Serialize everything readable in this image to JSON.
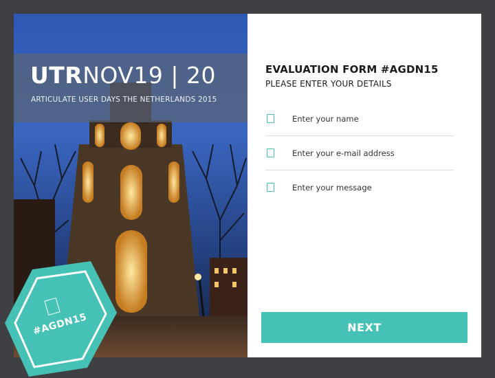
{
  "header": {
    "title_bold": "UTR",
    "title_rest": "NOV19 | 20",
    "subtitle": "ARTICULATE USER DAYS THE NETHERLANDS 2015"
  },
  "badge": {
    "label": "#AGDN15",
    "icon": "document-icon",
    "color": "#45c2b5"
  },
  "form": {
    "title": "EVALUATION FORM #AGDN15",
    "subtitle": "PLEASE ENTER YOUR DETAILS",
    "fields": [
      {
        "placeholder": "Enter your name",
        "icon": "checkbox-icon"
      },
      {
        "placeholder": "Enter your e-mail address",
        "icon": "checkbox-icon"
      },
      {
        "placeholder": "Enter your message",
        "icon": "checkbox-icon"
      }
    ],
    "next_label": "NEXT"
  },
  "colors": {
    "accent": "#45c2b5",
    "background": "#3f4043",
    "panel": "#ffffff"
  }
}
